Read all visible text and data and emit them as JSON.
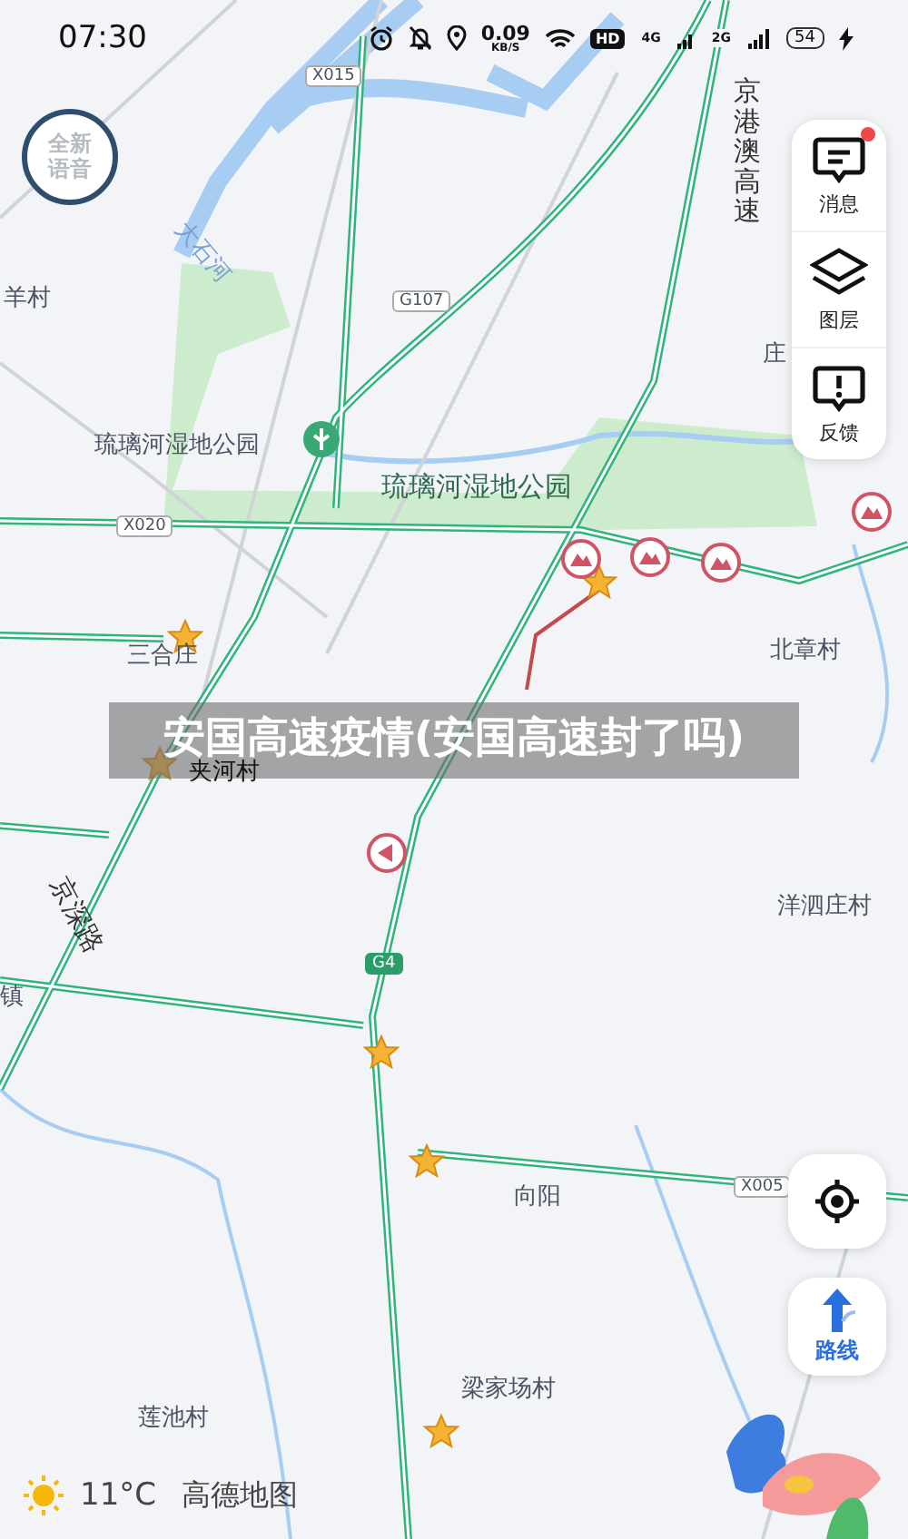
{
  "status_bar": {
    "time": "07:30",
    "speed": "0.09",
    "speed_unit": "KB/S",
    "hd": "HD",
    "net_1": "4G",
    "net_2": "2G",
    "battery": "54"
  },
  "voice_badge": "全新语音",
  "side_panel": [
    {
      "label": "消息",
      "kind": "message",
      "badge": true
    },
    {
      "label": "图层",
      "kind": "layers",
      "badge": false
    },
    {
      "label": "反馈",
      "kind": "feedback",
      "badge": false
    }
  ],
  "map_labels": [
    {
      "text": "X015",
      "kind": "road"
    },
    {
      "text": "羊村",
      "kind": "place"
    },
    {
      "text": "大石河",
      "kind": "river"
    },
    {
      "text": "G107",
      "kind": "road"
    },
    {
      "text": "琉璃河湿地公园",
      "kind": "place"
    },
    {
      "text": "琉璃河湿地公园",
      "kind": "park"
    },
    {
      "text": "X020",
      "kind": "road"
    },
    {
      "text": "京港澳高速",
      "kind": "vertical"
    },
    {
      "text": "庄",
      "kind": "place"
    },
    {
      "text": "三合庄",
      "kind": "place"
    },
    {
      "text": "北章村",
      "kind": "place"
    },
    {
      "text": "夹河村",
      "kind": "covered"
    },
    {
      "text": "京深路",
      "kind": "slanted"
    },
    {
      "text": "镇",
      "kind": "place"
    },
    {
      "text": "洋泗庄村",
      "kind": "place"
    },
    {
      "text": "G4",
      "kind": "highway"
    },
    {
      "text": "向阳",
      "kind": "place"
    },
    {
      "text": "X005",
      "kind": "road"
    },
    {
      "text": "梁家场村",
      "kind": "place"
    },
    {
      "text": "莲池村",
      "kind": "place"
    }
  ],
  "banner": "安国高速疫情(安国高速封了吗)",
  "weather": {
    "temperature": "11°C"
  },
  "brand": "高德地图",
  "route_button": "路线"
}
